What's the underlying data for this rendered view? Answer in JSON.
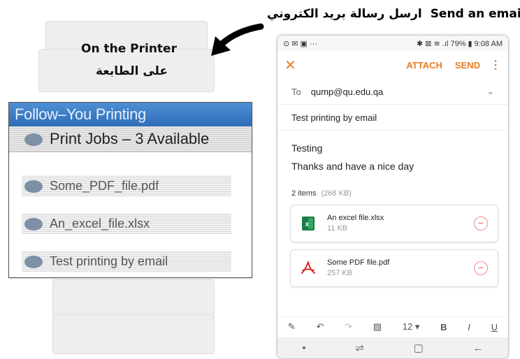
{
  "heading": {
    "arabic": "ارسل رسالة بريد الكتروني",
    "english": "Send an email"
  },
  "printer_label": {
    "english": "On the Printer",
    "arabic": "على الطابعة"
  },
  "printer_panel": {
    "title": "Follow–You Printing",
    "subtitle": "Print Jobs – 3 Available",
    "jobs": [
      "Some_PDF_file.pdf",
      "An_excel_file.xlsx",
      "Test printing by email"
    ]
  },
  "phone": {
    "status": {
      "left": "⊙ ✉ ▣ ···",
      "right": "✱ ⊠ ≋ .ıl 79% ▮ 9:08 AM"
    },
    "appbar": {
      "close": "✕",
      "attach": "ATTACH",
      "send": "SEND",
      "more": "⋮"
    },
    "to_label": "To",
    "to_value": "qump@qu.edu.qa",
    "subject": "Test printing by email",
    "body_line1": "Testing",
    "body_line2": "Thanks and have a nice day",
    "items_count": "2 items",
    "items_size": "(268 KB)",
    "attachments": [
      {
        "name": "An excel file.xlsx",
        "size": "11 KB",
        "icon": "excel-icon",
        "color": "#1d7a45"
      },
      {
        "name": "Some PDF file.pdf",
        "size": "257 KB",
        "icon": "pdf-icon",
        "color": "#d9342b"
      }
    ],
    "toolbar": {
      "font_size": "12",
      "bold": "B",
      "italic": "I",
      "underline": "U"
    }
  }
}
